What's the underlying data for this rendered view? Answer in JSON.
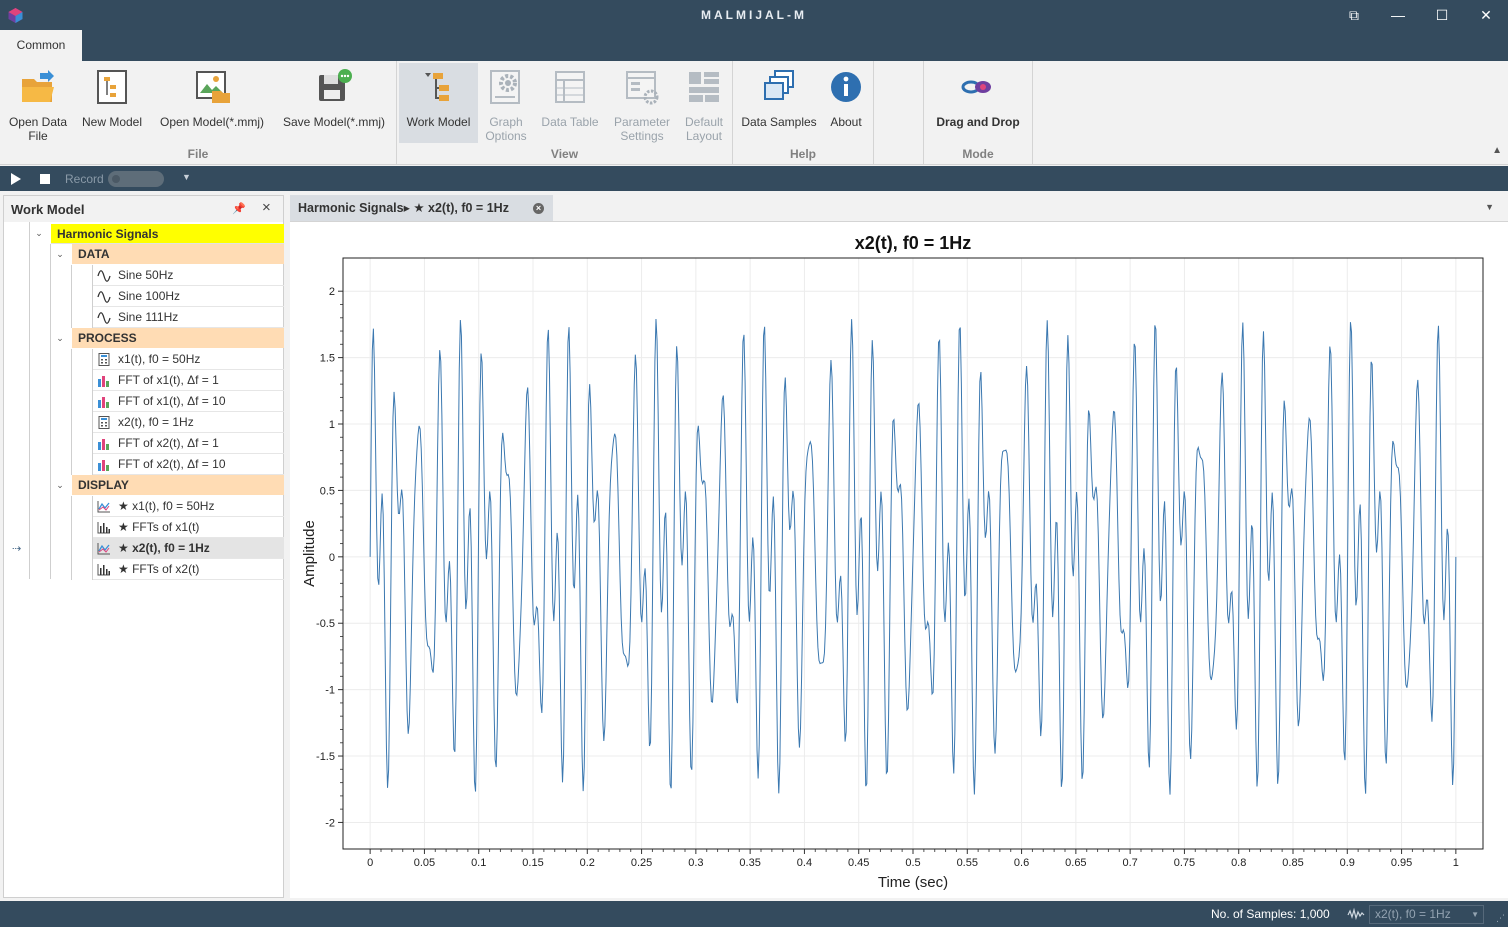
{
  "window": {
    "title": "MALMIJAL-M",
    "restore_label": "⧉",
    "minimize_label": "—",
    "maximize_label": "☐",
    "close_label": "✕"
  },
  "ribbon": {
    "tab": "Common",
    "buttons": {
      "open_data_file": "Open Data\nFile",
      "new_model": "New Model",
      "open_model": "Open Model(*.mmj)",
      "save_model": "Save Model(*.mmj)",
      "work_model": "Work Model",
      "graph_options": "Graph\nOptions",
      "data_table": "Data Table",
      "parameter_settings": "Parameter\nSettings",
      "default_layout": "Default\nLayout",
      "data_samples": "Data Samples",
      "about": "About",
      "drag_and_drop": "Drag and Drop"
    },
    "groups": {
      "file": "File",
      "view": "View",
      "help": "Help",
      "mode": "Mode"
    }
  },
  "playbar": {
    "record_label": "Record"
  },
  "work_model": {
    "title": "Work Model",
    "root": "Harmonic Signals",
    "categories": {
      "data": "DATA",
      "process": "PROCESS",
      "display": "DISPLAY"
    },
    "data_items": [
      "Sine 50Hz",
      "Sine 100Hz",
      "Sine 111Hz"
    ],
    "process_items": [
      "x1(t), f0 = 50Hz",
      "FFT of x1(t), Δf = 1",
      "FFT of x1(t), Δf = 10",
      "x2(t), f0 = 1Hz",
      "FFT of x2(t), Δf = 1",
      "FFT of x2(t), Δf = 10"
    ],
    "display_items": [
      "★ x1(t), f0 = 50Hz",
      "★ FFTs of x1(t)",
      "★ x2(t), f0 = 1Hz",
      "★ FFTs of x2(t)"
    ]
  },
  "document_tab": {
    "label": "Harmonic Signals▸ ★ x2(t), f0 = 1Hz"
  },
  "chart_data": {
    "type": "line",
    "title": "x2(t), f0 = 1Hz",
    "xlabel": "Time (sec)",
    "ylabel": "Amplitude",
    "xlim": [
      -0.025,
      1.025
    ],
    "ylim": [
      -2.2,
      2.25
    ],
    "x_ticks": [
      "0",
      "0.05",
      "0.1",
      "0.15",
      "0.2",
      "0.25",
      "0.3",
      "0.35",
      "0.4",
      "0.45",
      "0.5",
      "0.55",
      "0.6",
      "0.65",
      "0.7",
      "0.75",
      "0.8",
      "0.85",
      "0.9",
      "0.95",
      "1"
    ],
    "y_ticks": [
      "2",
      "1.5",
      "1",
      "0.5",
      "0",
      "-0.5",
      "-1",
      "-1.5",
      "-2"
    ],
    "grid": true,
    "series": [
      {
        "color": "#3b78b0",
        "samples": 1000,
        "t_range": [
          0,
          1
        ],
        "components": [
          {
            "freq_hz": 50,
            "amplitude": 1
          },
          {
            "freq_hz": 100,
            "amplitude": 0.5
          },
          {
            "freq_hz": 111,
            "amplitude": 0.5
          }
        ]
      }
    ]
  },
  "status": {
    "samples": "No. of Samples: 1,000",
    "selector": "x2(t), f0 = 1Hz"
  },
  "colors": {
    "chrome": "#344b5e",
    "root_highlight": "#ffff00",
    "category_bg": "#ffdcb4",
    "line": "#3b78b0"
  }
}
